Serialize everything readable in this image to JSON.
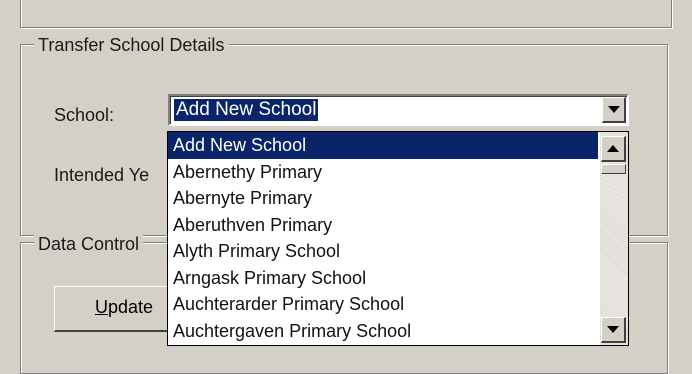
{
  "transfer_group": {
    "title": "Transfer School Details",
    "school_label": "School:",
    "intended_label": "Intended Ye"
  },
  "school_combo": {
    "value": "Add New School",
    "options": [
      "Add New School",
      "Abernethy Primary",
      "Abernyte Primary",
      "Aberuthven Primary",
      "Alyth Primary School",
      "Arngask Primary School",
      "Auchterarder Primary School",
      "Auchtergaven Primary School"
    ],
    "selected_index": 0
  },
  "data_group": {
    "title": "Data Control",
    "update_button": "Update"
  }
}
